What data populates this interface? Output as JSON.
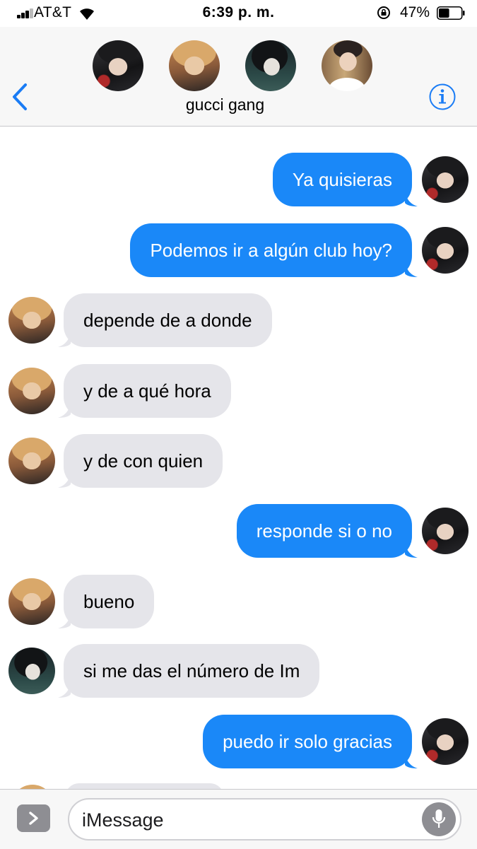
{
  "status_bar": {
    "carrier": "AT&T",
    "time": "6:39 p. m.",
    "battery_percent": "47%",
    "battery_level": 0.47
  },
  "header": {
    "group_name": "gucci gang",
    "back_icon": "chevron-left-icon",
    "info_icon": "info-icon"
  },
  "messages": [
    {
      "direction": "outgoing",
      "text": "Ya quisieras",
      "avatar": "a"
    },
    {
      "direction": "outgoing",
      "text": "Podemos ir a algún club hoy?",
      "avatar": "a"
    },
    {
      "direction": "incoming",
      "text": "depende de a donde",
      "avatar": "b"
    },
    {
      "direction": "incoming",
      "text": "y de a qué hora",
      "avatar": "b"
    },
    {
      "direction": "incoming",
      "text": "y de con quien",
      "avatar": "b"
    },
    {
      "direction": "outgoing",
      "text": "responde si o no",
      "avatar": "a"
    },
    {
      "direction": "incoming",
      "text": "bueno",
      "avatar": "b"
    },
    {
      "direction": "incoming",
      "text": "si me das el número de Im",
      "avatar": "c"
    },
    {
      "direction": "outgoing",
      "text": "puedo ir solo gracias",
      "avatar": "a"
    }
  ],
  "input": {
    "placeholder": "iMessage",
    "apps_icon": "chevron-right-icon",
    "mic_icon": "microphone-icon"
  },
  "colors": {
    "outgoing_bubble": "#1a88f8",
    "incoming_bubble": "#e5e5ea",
    "accent": "#1a7cf5"
  }
}
